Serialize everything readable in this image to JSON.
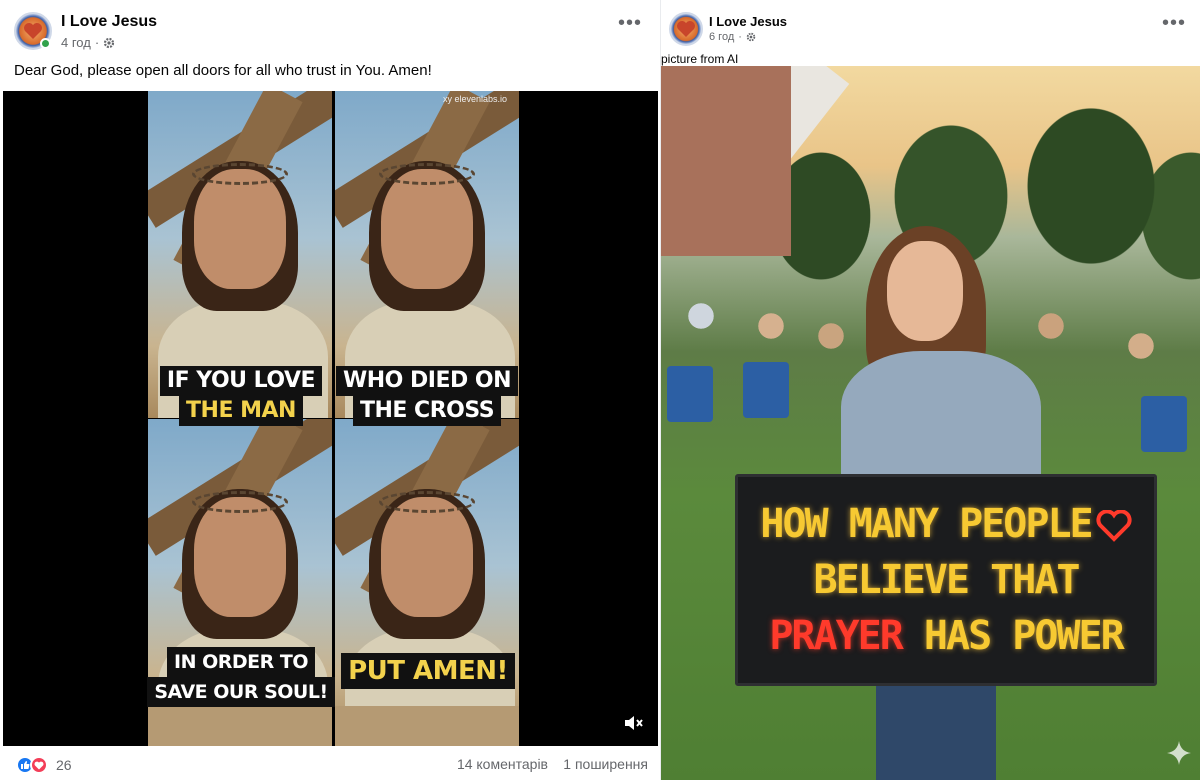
{
  "post_left": {
    "page_name": "I Love Jesus",
    "time": "4 год",
    "caption": "Dear God, please open all doors for all who trust in You. Amen!",
    "video": {
      "watermark": "xy  elevenlabs.io",
      "captions": {
        "top_left": [
          "IF YOU LOVE",
          "THE MAN"
        ],
        "top_right": [
          "WHO DIED ON",
          "THE CROSS"
        ],
        "bottom_left": [
          "IN ORDER TO",
          "SAVE OUR SOUL!"
        ],
        "bottom_right": [
          "PUT AMEN!"
        ]
      }
    },
    "reactions": {
      "count": "26",
      "types": [
        "like-icon",
        "love-icon"
      ]
    },
    "comments": "14 коментарів",
    "shares": "1 поширення"
  },
  "post_right": {
    "page_name": "I Love Jesus",
    "time": "6 год",
    "ai_label": "picture from AI",
    "sign": {
      "line1": "HOW MANY PEOPLE",
      "line2": "BELIEVE THAT",
      "line3_red": "PRAYER",
      "line3_yellow": "HAS POWER"
    }
  },
  "colors": {
    "fb_blue": "#1877f2",
    "love_red": "#f33e58",
    "online_green": "#31a24c",
    "caption_yellow": "#f3d24c",
    "led_yellow": "#f7c932",
    "led_red": "#ff3a2b"
  }
}
